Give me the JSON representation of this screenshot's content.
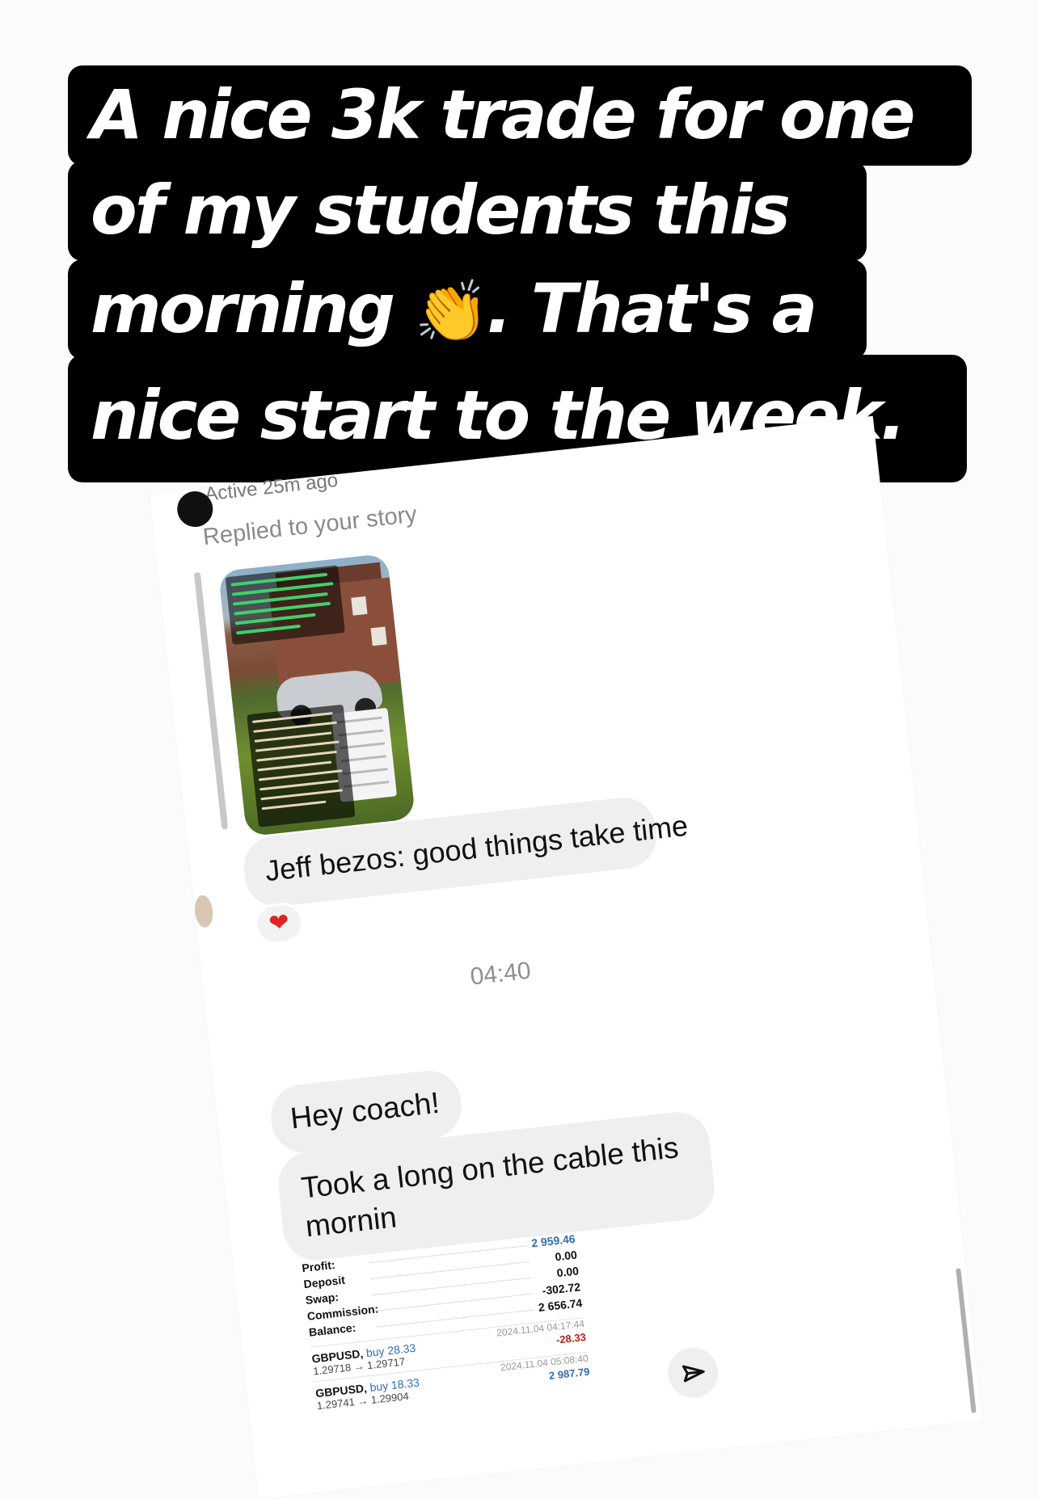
{
  "story_caption": {
    "line1": "A nice 3k trade for one",
    "line2": "of my students this",
    "line3_pre": "morning ",
    "line3_emoji": "👏",
    "line3_post": ". That's a",
    "line4": "nice start to the week."
  },
  "dm": {
    "active_status": "Active 25m ago",
    "replied_label": "Replied to your story",
    "reply_message": "Jeff bezos: good things take time",
    "reaction": "❤",
    "timestamp": "04:40",
    "messages": [
      "Hey coach!",
      "Took a long on the cable this mornin"
    ],
    "account": {
      "rows": [
        {
          "label": "Profit:",
          "value": "2 959.46"
        },
        {
          "label": "Deposit",
          "value": "0.00"
        },
        {
          "label": "Swap:",
          "value": "0.00"
        },
        {
          "label": "Commission:",
          "value": "-302.72"
        },
        {
          "label": "Balance:",
          "value": "2 656.74"
        }
      ],
      "trades": [
        {
          "symbol": "GBPUSD,",
          "side": "buy 28.33",
          "prices": "1.29718 → 1.29717",
          "time": "2024.11.04 04:17:44",
          "pl": "-28.33"
        },
        {
          "symbol": "GBPUSD,",
          "side": "buy 18.33",
          "prices": "1.29741 → 1.29904",
          "time": "2024.11.04 05:08:40",
          "pl": "2 987.79"
        }
      ]
    },
    "icons": {
      "send": "send-icon",
      "reaction": "heart-icon"
    }
  }
}
